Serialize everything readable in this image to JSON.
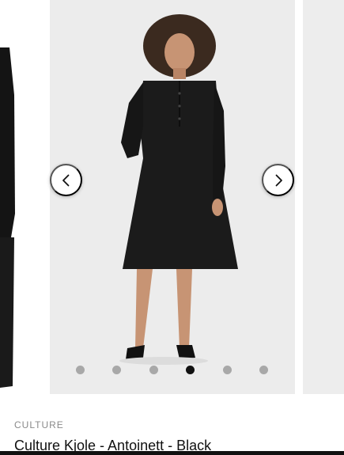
{
  "carousel": {
    "prev_icon": "chevron-left-icon",
    "next_icon": "chevron-right-icon",
    "dot_count": 6,
    "active_dot_index": 3,
    "colors": {
      "slide_bg": "#ececec",
      "dress": "#1a1a1a",
      "dot": "#a8a8a8",
      "dot_active": "#111111"
    }
  },
  "product": {
    "brand": "CULTURE",
    "title": "Culture Kjole - Antoinett - Black"
  }
}
